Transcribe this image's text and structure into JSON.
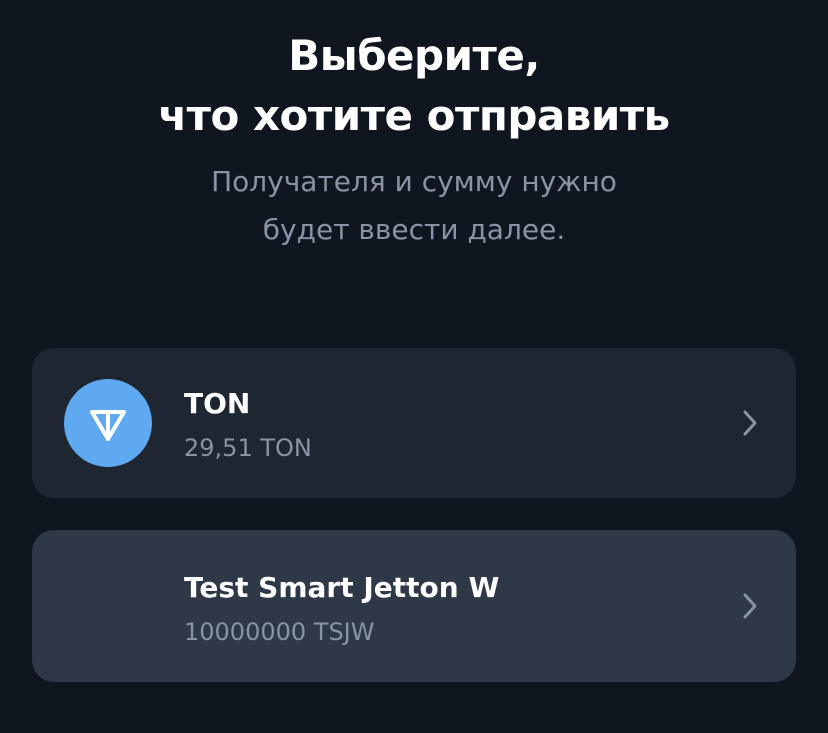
{
  "header": {
    "title_line1": "Выберите,",
    "title_line2": "что хотите отправить",
    "subtitle_line1": "Получателя и сумму нужно",
    "subtitle_line2": "будет ввести далее."
  },
  "tokens": [
    {
      "name": "TON",
      "balance": "29,51 TON",
      "icon": "ton-logo-icon",
      "icon_color": "#5fa9f0"
    },
    {
      "name": "Test Smart Jetton W",
      "balance": "10000000 TSJW",
      "icon": null
    }
  ],
  "colors": {
    "background": "#10161f",
    "card": "#1e2632",
    "card_highlighted": "#2e3847",
    "text_primary": "#ffffff",
    "text_secondary": "#8994a3",
    "accent": "#5fa9f0"
  }
}
